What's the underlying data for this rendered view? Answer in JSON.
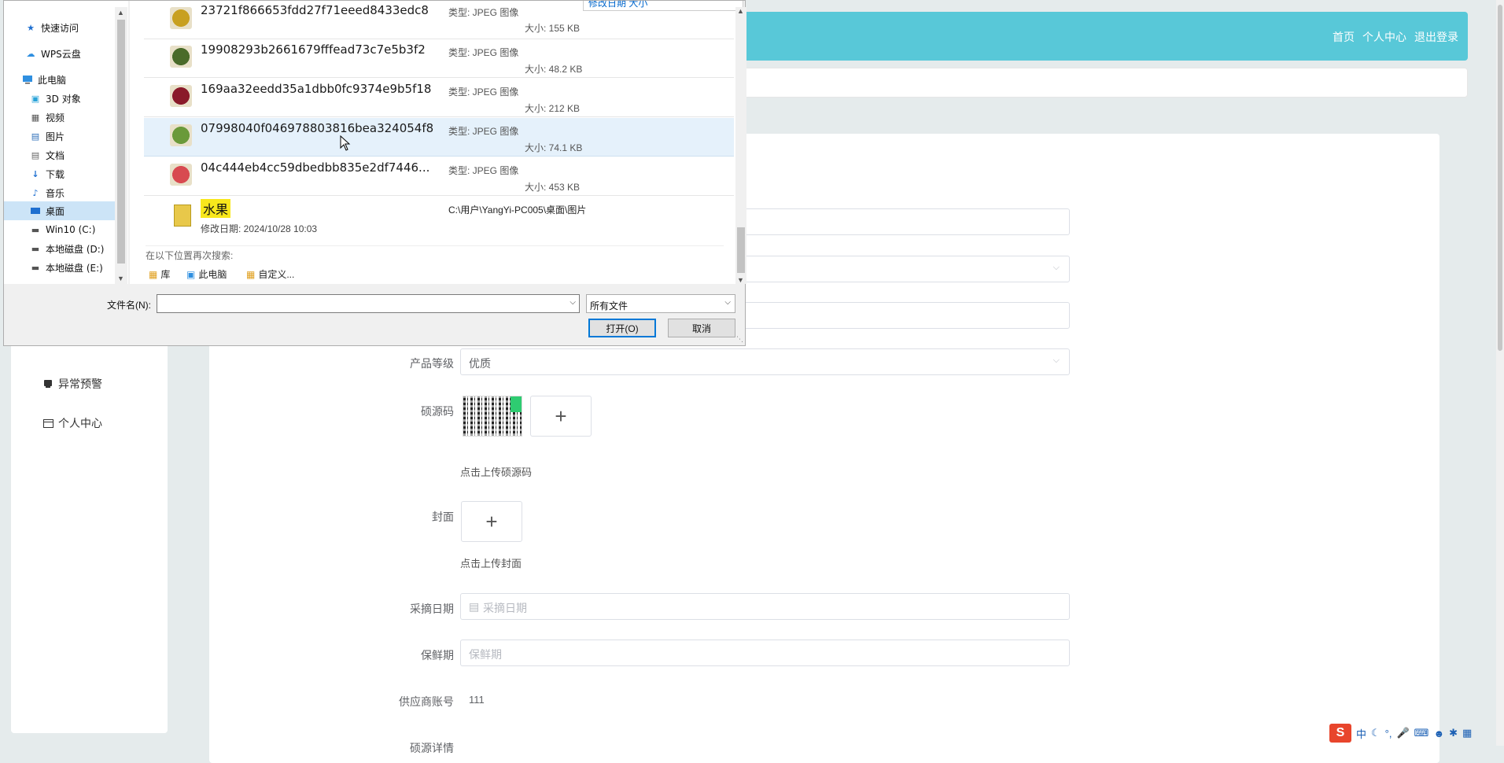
{
  "topnav": {
    "home": "首页",
    "profile": "个人中心",
    "logout": "退出登录"
  },
  "sidebar": {
    "items": [
      {
        "label": "异常预警",
        "icon": "alert-icon"
      },
      {
        "label": "个人中心",
        "icon": "calendar-icon"
      }
    ]
  },
  "form": {
    "grade": {
      "label": "产品等级",
      "value": "优质"
    },
    "trace_code": {
      "label": "硕源码",
      "hint": "点击上传硕源码"
    },
    "cover": {
      "label": "封面",
      "hint": "点击上传封面"
    },
    "pick_date": {
      "label": "采摘日期",
      "placeholder": "采摘日期"
    },
    "shelf_life": {
      "label": "保鲜期",
      "placeholder": "保鲜期"
    },
    "supplier": {
      "label": "供应商账号",
      "value": "111"
    },
    "next_label": "硕源详情"
  },
  "dialog": {
    "header_cols": "修改日期    大小",
    "nav": [
      {
        "label": "快速访问",
        "icon": "star-icon"
      },
      {
        "label": "WPS云盘",
        "icon": "cloud-icon"
      },
      {
        "label": "此电脑",
        "icon": "computer-icon"
      },
      {
        "label": "3D 对象",
        "icon": "cube-icon"
      },
      {
        "label": "视频",
        "icon": "video-icon"
      },
      {
        "label": "图片",
        "icon": "picture-icon"
      },
      {
        "label": "文档",
        "icon": "document-icon"
      },
      {
        "label": "下载",
        "icon": "download-icon"
      },
      {
        "label": "音乐",
        "icon": "music-icon"
      },
      {
        "label": "桌面",
        "icon": "desktop-icon"
      },
      {
        "label": "Win10 (C:)",
        "icon": "drive-icon"
      },
      {
        "label": "本地磁盘 (D:)",
        "icon": "drive-icon"
      },
      {
        "label": "本地磁盘 (E:)",
        "icon": "drive-icon"
      }
    ],
    "files": [
      {
        "name": "23721f866653fdd27f71eeed8433edc8",
        "type": "类型: JPEG 图像",
        "size": "大小: 155 KB",
        "color": "#c8a020"
      },
      {
        "name": "19908293b2661679fffead73c7e5b3f2",
        "type": "类型: JPEG 图像",
        "size": "大小: 48.2 KB",
        "color": "#4a6b2a"
      },
      {
        "name": "169aa32eedd35a1dbb0fc9374e9b5f18",
        "type": "类型: JPEG 图像",
        "size": "大小: 212 KB",
        "color": "#8a1a2a"
      },
      {
        "name": "07998040f046978803816bea324054f8",
        "type": "类型: JPEG 图像",
        "size": "大小: 74.1 KB",
        "color": "#6a9a3a"
      },
      {
        "name": "04c444eb4cc59dbedbb835e2df7446...",
        "type": "类型: JPEG 图像",
        "size": "大小: 453 KB",
        "color": "#d84a50"
      }
    ],
    "folder": {
      "name": "水果",
      "date": "修改日期: 2024/10/28 10:03",
      "path": "C:\\用户\\YangYi-PC005\\桌面\\图片"
    },
    "search_again": {
      "title": "在以下位置再次搜索:",
      "library": "库",
      "this_pc": "此电脑",
      "custom": "自定义..."
    },
    "filename_label": "文件名(N):",
    "filename_value": "",
    "filter": "所有文件",
    "open_btn": "打开(O)",
    "cancel_btn": "取消"
  },
  "tray": {
    "ime_logo": "S",
    "ime_mode": "中"
  }
}
